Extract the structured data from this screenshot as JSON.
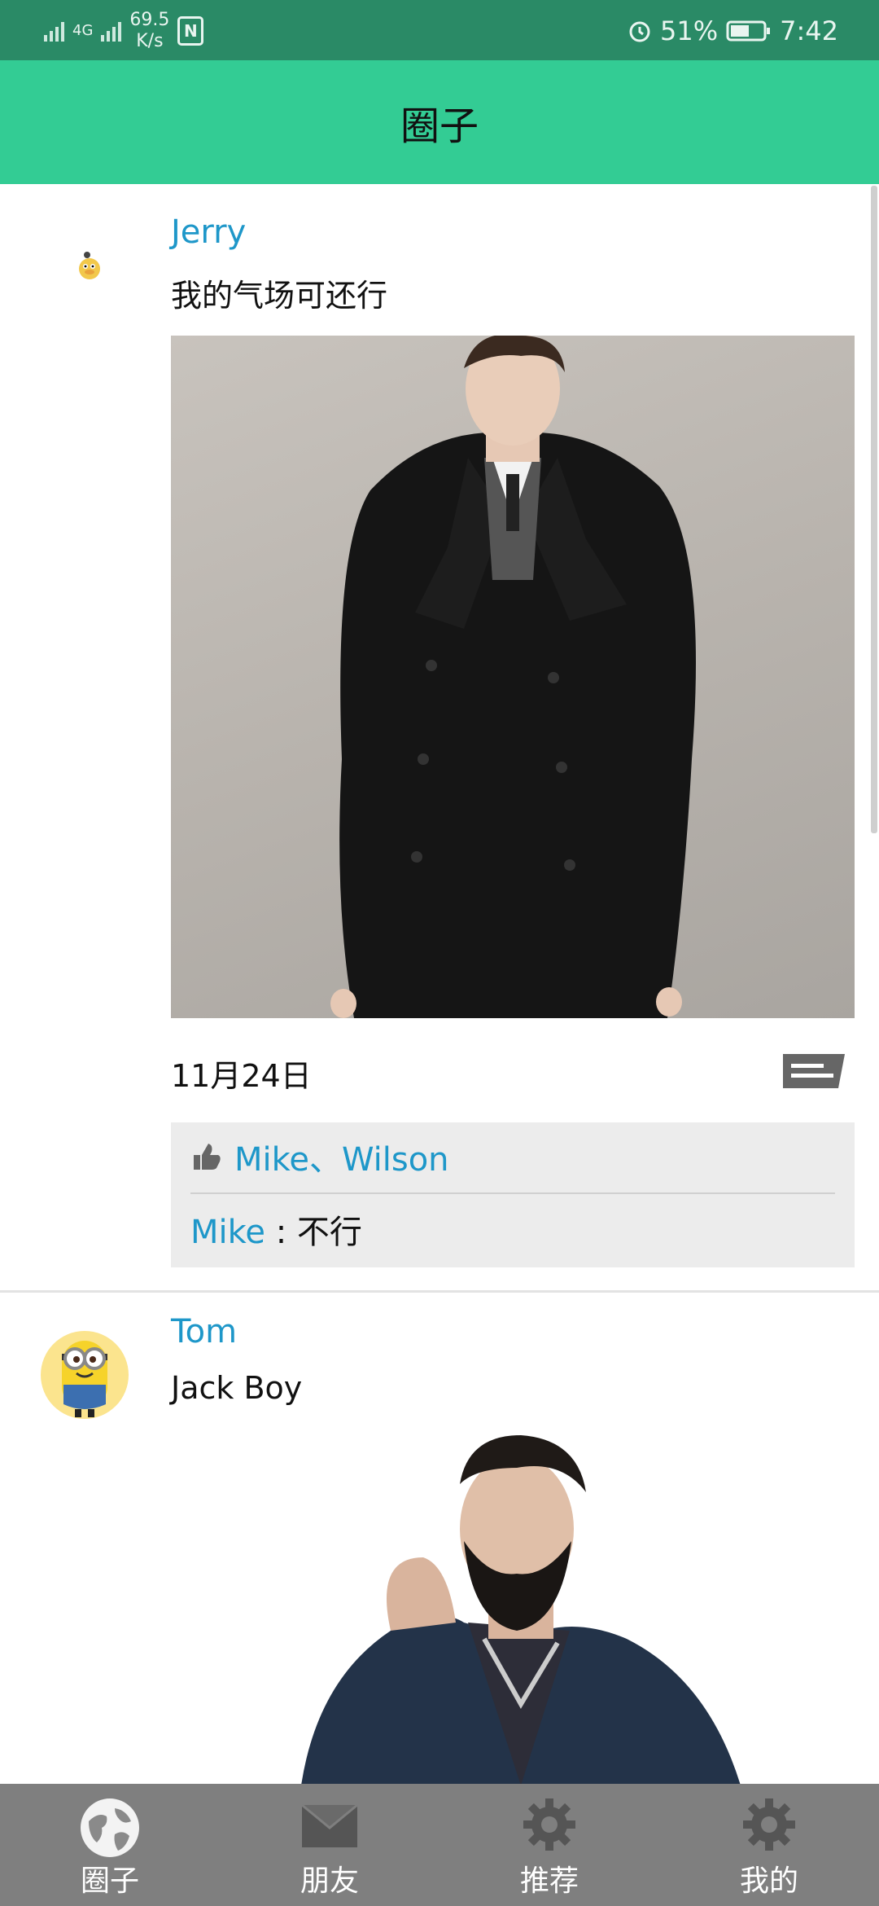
{
  "status_bar": {
    "network_speed_value": "69.5",
    "network_speed_unit": "K/s",
    "signal_label": "4G",
    "battery_percent": "51%",
    "time": "7:42"
  },
  "header": {
    "title": "圈子"
  },
  "posts": [
    {
      "username": "Jerry",
      "text": "我的气场可还行",
      "date": "11月24日",
      "likes": "Mike、Wilson",
      "comment": {
        "author": "Mike",
        "separator": " : ",
        "text": "不行"
      }
    },
    {
      "username": "Tom",
      "text": "Jack Boy"
    }
  ],
  "bottom_nav": {
    "items": [
      {
        "label": "圈子",
        "icon": "globe-icon"
      },
      {
        "label": "朋友",
        "icon": "envelope-icon"
      },
      {
        "label": "推荐",
        "icon": "gear-icon"
      },
      {
        "label": "我的",
        "icon": "gear-icon"
      }
    ]
  }
}
